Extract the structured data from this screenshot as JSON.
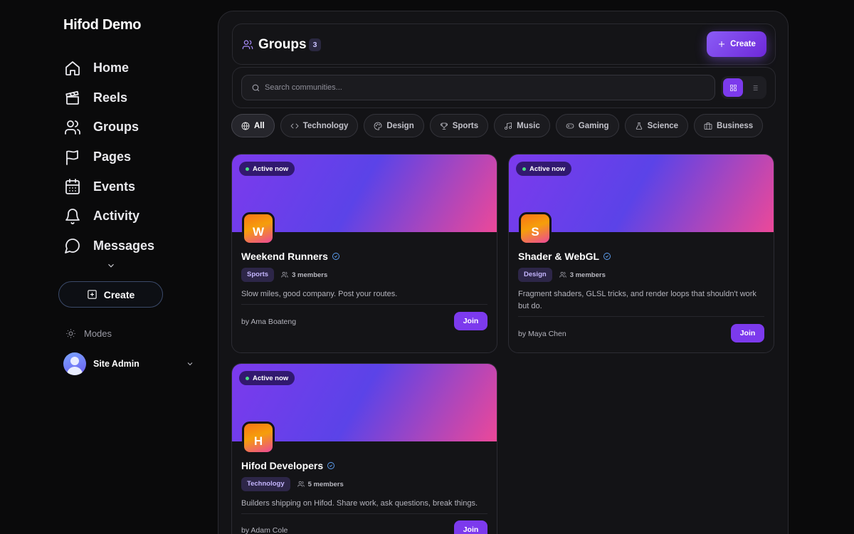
{
  "app": {
    "brand": "Hifod Demo"
  },
  "sidebar": {
    "items": [
      {
        "label": "Home",
        "icon": "home-icon"
      },
      {
        "label": "Reels",
        "icon": "clapperboard-icon"
      },
      {
        "label": "Groups",
        "icon": "users-icon"
      },
      {
        "label": "Pages",
        "icon": "flag-icon"
      },
      {
        "label": "Events",
        "icon": "calendar-icon"
      },
      {
        "label": "Activity",
        "icon": "bell-icon"
      },
      {
        "label": "Messages",
        "icon": "message-circle-icon"
      }
    ],
    "create_label": "Create",
    "modes_label": "Modes",
    "user_name": "Site Admin"
  },
  "header": {
    "title": "Groups",
    "count": "3",
    "create_label": "Create"
  },
  "search": {
    "placeholder": "Search communities..."
  },
  "view": {
    "selected": "grid"
  },
  "filters": [
    {
      "label": "All",
      "icon": "globe-icon",
      "active": true
    },
    {
      "label": "Technology",
      "icon": "code-icon",
      "active": false
    },
    {
      "label": "Design",
      "icon": "palette-icon",
      "active": false
    },
    {
      "label": "Sports",
      "icon": "trophy-icon",
      "active": false
    },
    {
      "label": "Music",
      "icon": "music-icon",
      "active": false
    },
    {
      "label": "Gaming",
      "icon": "gamepad-icon",
      "active": false
    },
    {
      "label": "Science",
      "icon": "flask-icon",
      "active": false
    },
    {
      "label": "Business",
      "icon": "briefcase-icon",
      "active": false
    }
  ],
  "groups": [
    {
      "status": "Active now",
      "initial": "W",
      "name": "Weekend Runners",
      "tag": "Sports",
      "members": "3 members",
      "description": "Slow miles, good company. Post your routes.",
      "owner": "by Ama Boateng",
      "join_label": "Join"
    },
    {
      "status": "Active now",
      "initial": "S",
      "name": "Shader & WebGL",
      "tag": "Design",
      "members": "3 members",
      "description": "Fragment shaders, GLSL tricks, and render loops that shouldn't work but do.",
      "owner": "by Maya Chen",
      "join_label": "Join"
    },
    {
      "status": "Active now",
      "initial": "H",
      "name": "Hifod Developers",
      "tag": "Technology",
      "members": "5 members",
      "description": "Builders shipping on Hifod. Share work, ask questions, break things.",
      "owner": "by Adam Cole",
      "join_label": "Join"
    }
  ],
  "colors": {
    "accent": "#7c3aed",
    "background": "#0a0a0b",
    "panel": "#131316",
    "live_dot": "#4ade80",
    "verified": "#60a5fa"
  }
}
